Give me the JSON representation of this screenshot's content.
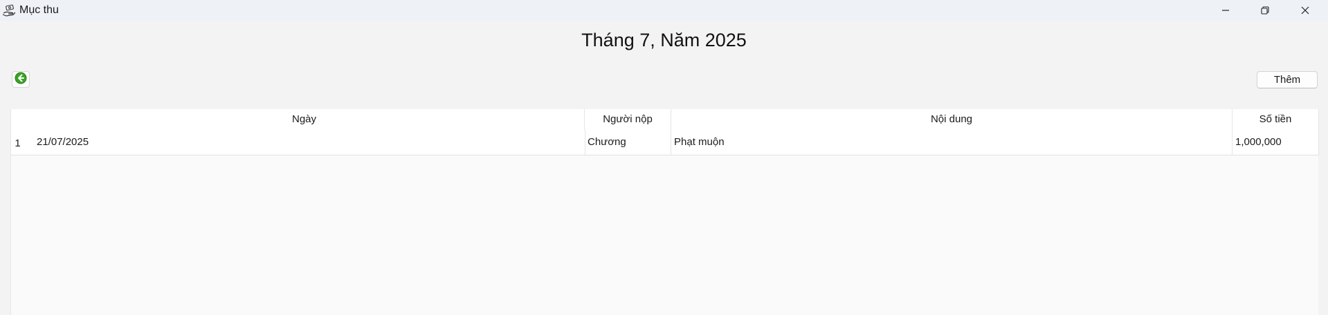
{
  "window": {
    "title": "Mục thu",
    "icon": "money-hand-icon",
    "controls": [
      "minimize-icon",
      "restore-icon",
      "close-icon"
    ]
  },
  "heading": "Tháng 7, Năm 2025",
  "toolbar": {
    "back_icon": "arrow-left-circle-icon",
    "back_color": "#3aa324",
    "add_label": "Thêm"
  },
  "table": {
    "columns": [
      "Ngày",
      "Người nộp",
      "Nội dung",
      "Số tiền"
    ],
    "rows": [
      {
        "index": "1",
        "ngay": "21/07/2025",
        "nguoi_nop": "Chương",
        "noi_dung": "Phạt muộn",
        "so_tien": "1,000,000"
      }
    ]
  }
}
